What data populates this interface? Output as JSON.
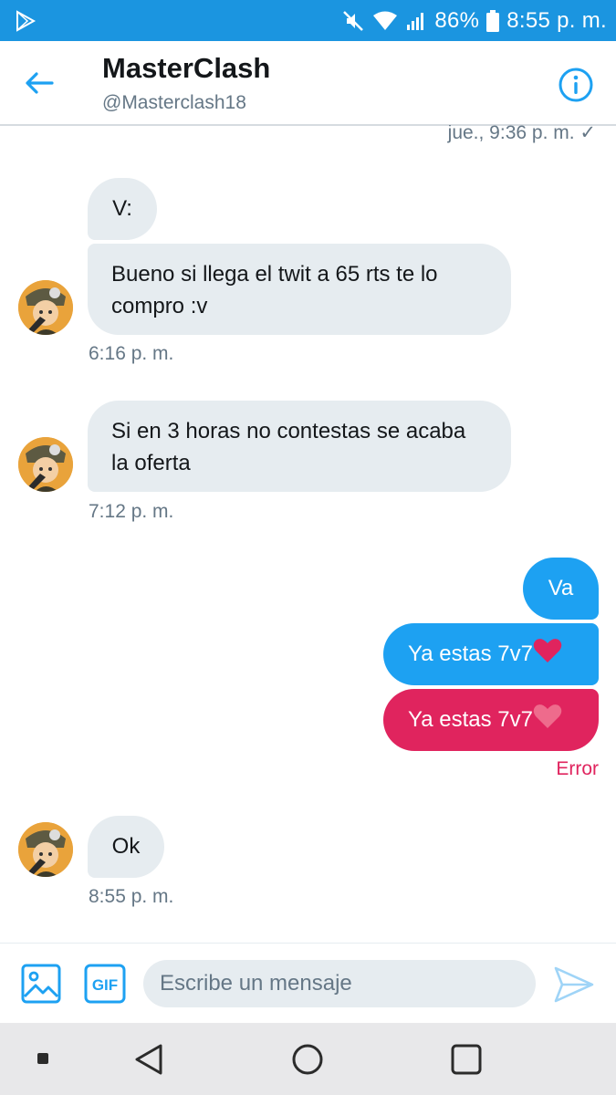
{
  "status_bar": {
    "battery": "86%",
    "time": "8:55 p. m."
  },
  "header": {
    "title": "MasterClash",
    "handle": "@Masterclash18"
  },
  "conversation": {
    "previous_timestamp": "jue., 9:36 p. m. ✓",
    "messages": [
      {
        "text": "V:"
      },
      {
        "text": "Bueno si llega el twit a 65 rts  te lo compro :v"
      },
      {
        "timestamp": "6:16 p. m."
      },
      {
        "text": "Si en 3 horas no contestas se acaba la oferta"
      },
      {
        "timestamp": "7:12 p. m."
      },
      {
        "text": "Va"
      },
      {
        "text": "Ya estas 7v7"
      },
      {
        "text": "Ya estas 7v7",
        "status": "Error"
      },
      {
        "text": "Ok"
      },
      {
        "timestamp": "8:55 p. m."
      }
    ]
  },
  "composer": {
    "placeholder": "Escribe un mensaje",
    "gif_label": "GIF"
  },
  "colors": {
    "accent": "#1da1f2",
    "error": "#e0245e",
    "incoming": "#e6ecf0"
  }
}
